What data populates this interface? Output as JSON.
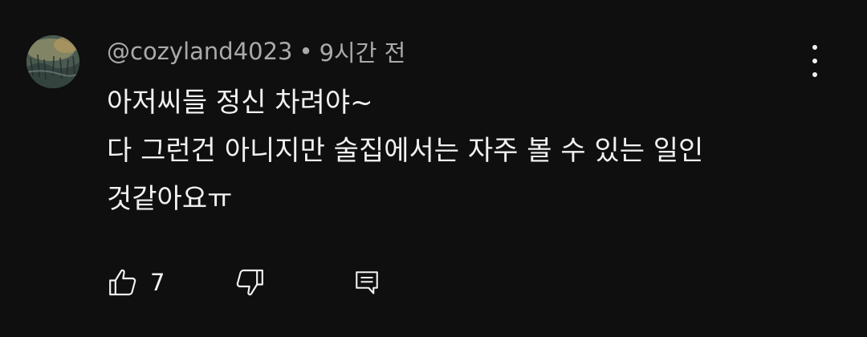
{
  "comment": {
    "author": "@cozyland4023",
    "separator": "•",
    "time_ago": "9시간 전",
    "lines": [
      "아저씨들 정신 차려야~",
      "다 그런건 아니지만 술집에서는 자주 볼 수 있는 일인",
      "것같아요ㅠ"
    ]
  },
  "actions": {
    "like_icon": "thumbs-up-icon",
    "like_count": "7",
    "dislike_icon": "thumbs-down-icon",
    "reply_icon": "reply-icon"
  },
  "menu": {
    "icon": "more-vert-icon"
  },
  "colors": {
    "background": "#0f0f0f",
    "text_primary": "#f1f1f1",
    "text_secondary": "#aaaaaa"
  }
}
